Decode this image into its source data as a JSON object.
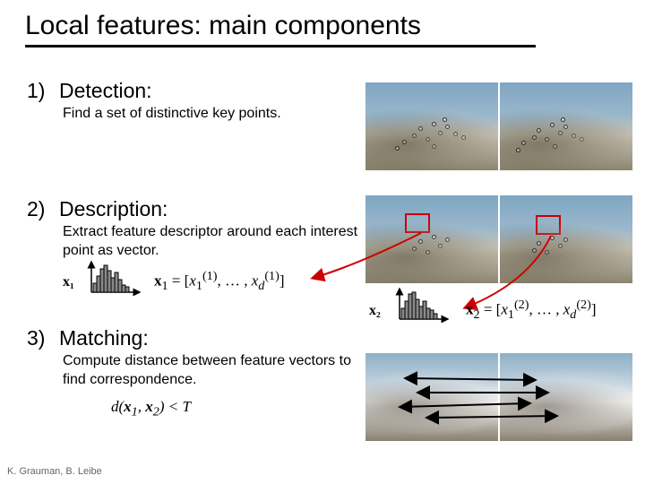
{
  "title": "Local features: main components",
  "sections": [
    {
      "num": "1)",
      "heading": "Detection:",
      "desc": "Find a set of distinctive key points."
    },
    {
      "num": "2)",
      "heading": "Description:",
      "desc": "Extract feature descriptor around each interest point as vector."
    },
    {
      "num": "3)",
      "heading": "Matching:",
      "desc": "Compute distance between feature vectors to find correspondence."
    }
  ],
  "formulas": {
    "x1_label": "x₁",
    "x2_label": "x₂",
    "x1_vec": "x₁ = [x₁⁽¹⁾, … , x_d⁽¹⁾]",
    "x2_vec": "x₂ = [x₁⁽²⁾, … , x_d⁽²⁾]",
    "dist": "d(x₁, x₂) < T"
  },
  "credit": "K. Grauman, B. Leibe"
}
